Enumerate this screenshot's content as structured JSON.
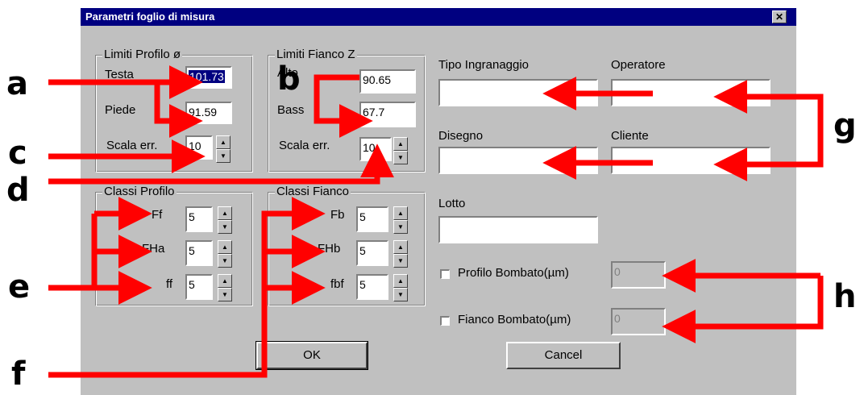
{
  "dialog": {
    "title": "Parametri foglio di misura",
    "close_label": "✕"
  },
  "limiti_profilo": {
    "title": "Limiti Profilo ø",
    "testa_label": "Testa",
    "testa_value": "101.73",
    "piede_label": "Piede",
    "piede_value": "91.59",
    "scala_label": "Scala err.",
    "scala_value": "10"
  },
  "limiti_fianco": {
    "title": "Limiti Fianco Z",
    "alto_label": "Alto",
    "alto_value": "90.65",
    "basso_label": "Bass",
    "basso_value": "67.7",
    "scala_label": "Scala err.",
    "scala_value": "10"
  },
  "classi_profilo": {
    "title": "Classi Profilo",
    "ff_label": "Ff",
    "ff_value": "5",
    "fha_label": "FHa",
    "fha_value": "5",
    "ff2_label": "ff",
    "ff2_value": "5"
  },
  "classi_fianco": {
    "title": "Classi Fianco",
    "fb_label": "Fb",
    "fb_value": "5",
    "fhb_label": "FHb",
    "fhb_value": "5",
    "fbf_label": "fbf",
    "fbf_value": "5"
  },
  "right": {
    "tipo_label": "Tipo Ingranaggio",
    "tipo_value": "",
    "operatore_label": "Operatore",
    "operatore_value": "",
    "disegno_label": "Disegno",
    "disegno_value": "",
    "cliente_label": "Cliente",
    "cliente_value": "",
    "lotto_label": "Lotto",
    "lotto_value": "",
    "profilo_bombato_label": "Profilo Bombato(µm)",
    "profilo_bombato_value": "0",
    "fianco_bombato_label": "Fianco Bombato(µm)",
    "fianco_bombato_value": "0"
  },
  "buttons": {
    "ok": "OK",
    "cancel": "Cancel"
  },
  "annotations": {
    "a": "a",
    "b": "b",
    "c": "c",
    "d": "d",
    "e": "e",
    "f": "f",
    "g": "g",
    "h": "h"
  },
  "colors": {
    "arrow": "#ff0000",
    "titlebar": "#000080",
    "dialog_bg": "#c0c0c0"
  }
}
